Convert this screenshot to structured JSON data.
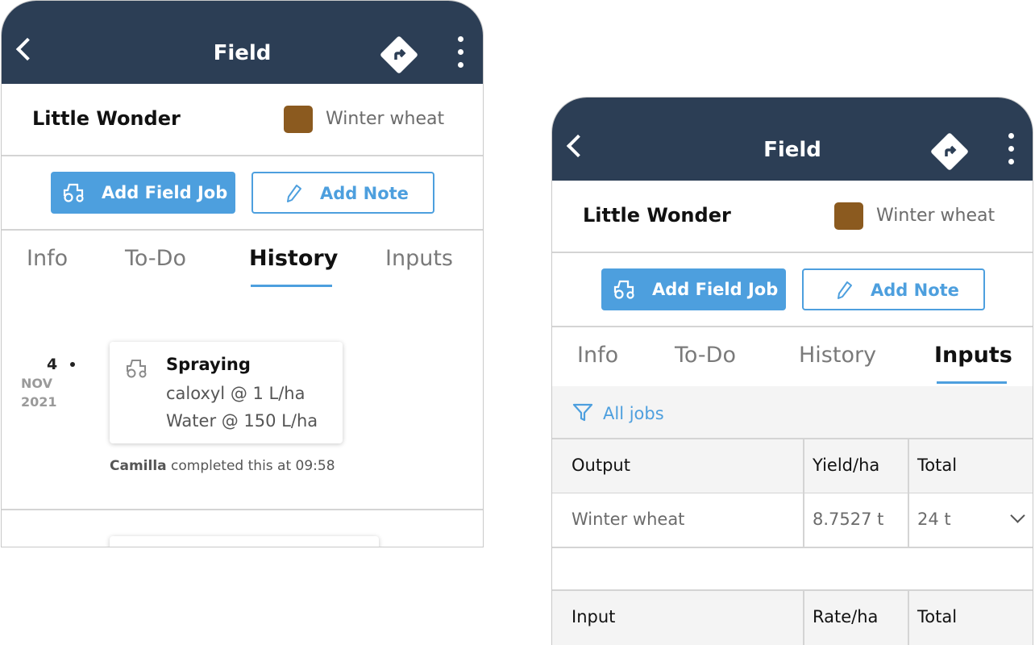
{
  "left": {
    "header": {
      "title": "Field",
      "back_icon": "chevron-left-icon",
      "nav_icon": "directions-icon",
      "menu_icon": "kebab-menu-icon"
    },
    "field": {
      "name": "Little Wonder",
      "crop": "Winter wheat",
      "crop_color": "#8b5a1f"
    },
    "actions": {
      "add_job": "Add Field Job",
      "add_note": "Add Note"
    },
    "tabs": [
      {
        "label": "Info"
      },
      {
        "label": "To-Do"
      },
      {
        "label": "History"
      },
      {
        "label": "Inputs"
      }
    ],
    "active_tab": "History",
    "history": [
      {
        "day": "4",
        "month": "NOV",
        "year": "2021",
        "job": "Spraying",
        "lines": [
          "caloxyl  @ 1 L/ha",
          "Water  @ 150 L/ha"
        ],
        "completed_by": "Camilla",
        "completed_text": "completed this at 09:58"
      }
    ]
  },
  "right": {
    "header": {
      "title": "Field",
      "back_icon": "chevron-left-icon",
      "nav_icon": "directions-icon",
      "menu_icon": "kebab-menu-icon"
    },
    "field": {
      "name": "Little Wonder",
      "crop": "Winter wheat",
      "crop_color": "#8b5a1f"
    },
    "actions": {
      "add_job": "Add Field Job",
      "add_note": "Add Note"
    },
    "tabs": [
      {
        "label": "Info"
      },
      {
        "label": "To-Do"
      },
      {
        "label": "History"
      },
      {
        "label": "Inputs"
      }
    ],
    "active_tab": "Inputs",
    "filter": {
      "label": "All jobs",
      "icon": "filter-icon"
    },
    "output_table": {
      "headers": [
        "Output",
        "Yield/ha",
        "Total"
      ],
      "rows": [
        [
          "Winter wheat",
          "8.7527 t",
          "24 t"
        ]
      ]
    },
    "input_table": {
      "headers": [
        "Input",
        "Rate/ha",
        "Total"
      ]
    }
  },
  "colors": {
    "header_bg": "#2c3e55",
    "accent": "#4d9fde"
  }
}
